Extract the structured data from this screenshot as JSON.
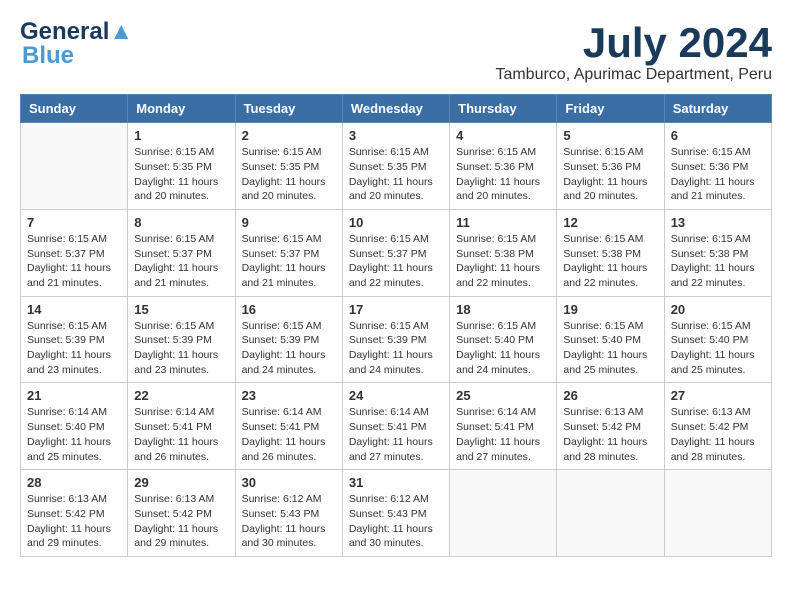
{
  "header": {
    "logo_line1": "General",
    "logo_line2": "Blue",
    "month": "July 2024",
    "location": "Tamburco, Apurimac Department, Peru"
  },
  "weekdays": [
    "Sunday",
    "Monday",
    "Tuesday",
    "Wednesday",
    "Thursday",
    "Friday",
    "Saturday"
  ],
  "weeks": [
    [
      {
        "day": "",
        "info": ""
      },
      {
        "day": "1",
        "info": "Sunrise: 6:15 AM\nSunset: 5:35 PM\nDaylight: 11 hours\nand 20 minutes."
      },
      {
        "day": "2",
        "info": "Sunrise: 6:15 AM\nSunset: 5:35 PM\nDaylight: 11 hours\nand 20 minutes."
      },
      {
        "day": "3",
        "info": "Sunrise: 6:15 AM\nSunset: 5:35 PM\nDaylight: 11 hours\nand 20 minutes."
      },
      {
        "day": "4",
        "info": "Sunrise: 6:15 AM\nSunset: 5:36 PM\nDaylight: 11 hours\nand 20 minutes."
      },
      {
        "day": "5",
        "info": "Sunrise: 6:15 AM\nSunset: 5:36 PM\nDaylight: 11 hours\nand 20 minutes."
      },
      {
        "day": "6",
        "info": "Sunrise: 6:15 AM\nSunset: 5:36 PM\nDaylight: 11 hours\nand 21 minutes."
      }
    ],
    [
      {
        "day": "7",
        "info": "Sunrise: 6:15 AM\nSunset: 5:37 PM\nDaylight: 11 hours\nand 21 minutes."
      },
      {
        "day": "8",
        "info": "Sunrise: 6:15 AM\nSunset: 5:37 PM\nDaylight: 11 hours\nand 21 minutes."
      },
      {
        "day": "9",
        "info": "Sunrise: 6:15 AM\nSunset: 5:37 PM\nDaylight: 11 hours\nand 21 minutes."
      },
      {
        "day": "10",
        "info": "Sunrise: 6:15 AM\nSunset: 5:37 PM\nDaylight: 11 hours\nand 22 minutes."
      },
      {
        "day": "11",
        "info": "Sunrise: 6:15 AM\nSunset: 5:38 PM\nDaylight: 11 hours\nand 22 minutes."
      },
      {
        "day": "12",
        "info": "Sunrise: 6:15 AM\nSunset: 5:38 PM\nDaylight: 11 hours\nand 22 minutes."
      },
      {
        "day": "13",
        "info": "Sunrise: 6:15 AM\nSunset: 5:38 PM\nDaylight: 11 hours\nand 22 minutes."
      }
    ],
    [
      {
        "day": "14",
        "info": "Sunrise: 6:15 AM\nSunset: 5:39 PM\nDaylight: 11 hours\nand 23 minutes."
      },
      {
        "day": "15",
        "info": "Sunrise: 6:15 AM\nSunset: 5:39 PM\nDaylight: 11 hours\nand 23 minutes."
      },
      {
        "day": "16",
        "info": "Sunrise: 6:15 AM\nSunset: 5:39 PM\nDaylight: 11 hours\nand 24 minutes."
      },
      {
        "day": "17",
        "info": "Sunrise: 6:15 AM\nSunset: 5:39 PM\nDaylight: 11 hours\nand 24 minutes."
      },
      {
        "day": "18",
        "info": "Sunrise: 6:15 AM\nSunset: 5:40 PM\nDaylight: 11 hours\nand 24 minutes."
      },
      {
        "day": "19",
        "info": "Sunrise: 6:15 AM\nSunset: 5:40 PM\nDaylight: 11 hours\nand 25 minutes."
      },
      {
        "day": "20",
        "info": "Sunrise: 6:15 AM\nSunset: 5:40 PM\nDaylight: 11 hours\nand 25 minutes."
      }
    ],
    [
      {
        "day": "21",
        "info": "Sunrise: 6:14 AM\nSunset: 5:40 PM\nDaylight: 11 hours\nand 25 minutes."
      },
      {
        "day": "22",
        "info": "Sunrise: 6:14 AM\nSunset: 5:41 PM\nDaylight: 11 hours\nand 26 minutes."
      },
      {
        "day": "23",
        "info": "Sunrise: 6:14 AM\nSunset: 5:41 PM\nDaylight: 11 hours\nand 26 minutes."
      },
      {
        "day": "24",
        "info": "Sunrise: 6:14 AM\nSunset: 5:41 PM\nDaylight: 11 hours\nand 27 minutes."
      },
      {
        "day": "25",
        "info": "Sunrise: 6:14 AM\nSunset: 5:41 PM\nDaylight: 11 hours\nand 27 minutes."
      },
      {
        "day": "26",
        "info": "Sunrise: 6:13 AM\nSunset: 5:42 PM\nDaylight: 11 hours\nand 28 minutes."
      },
      {
        "day": "27",
        "info": "Sunrise: 6:13 AM\nSunset: 5:42 PM\nDaylight: 11 hours\nand 28 minutes."
      }
    ],
    [
      {
        "day": "28",
        "info": "Sunrise: 6:13 AM\nSunset: 5:42 PM\nDaylight: 11 hours\nand 29 minutes."
      },
      {
        "day": "29",
        "info": "Sunrise: 6:13 AM\nSunset: 5:42 PM\nDaylight: 11 hours\nand 29 minutes."
      },
      {
        "day": "30",
        "info": "Sunrise: 6:12 AM\nSunset: 5:43 PM\nDaylight: 11 hours\nand 30 minutes."
      },
      {
        "day": "31",
        "info": "Sunrise: 6:12 AM\nSunset: 5:43 PM\nDaylight: 11 hours\nand 30 minutes."
      },
      {
        "day": "",
        "info": ""
      },
      {
        "day": "",
        "info": ""
      },
      {
        "day": "",
        "info": ""
      }
    ]
  ]
}
